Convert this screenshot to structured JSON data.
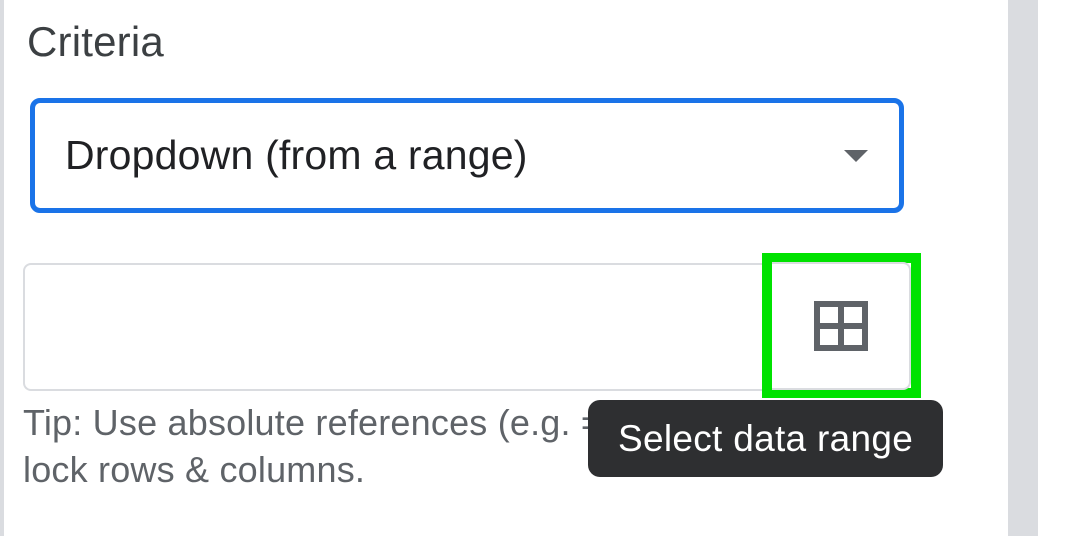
{
  "section": {
    "title": "Criteria"
  },
  "criteria_dropdown": {
    "selected_label": "Dropdown (from a range)"
  },
  "range_input": {
    "value": "",
    "placeholder": ""
  },
  "tip": {
    "text_line1": "Tip: Use absolute references (e.g. =$",
    "text_line2": "lock rows & columns."
  },
  "tooltip": {
    "text": "Select data range"
  },
  "icons": {
    "caret": "chevron-down-icon",
    "grid": "grid-range-icon"
  },
  "colors": {
    "accent": "#1a73e8",
    "highlight_box": "#00e200",
    "text_muted": "#5f6368",
    "tooltip_bg": "#2e2f31"
  }
}
